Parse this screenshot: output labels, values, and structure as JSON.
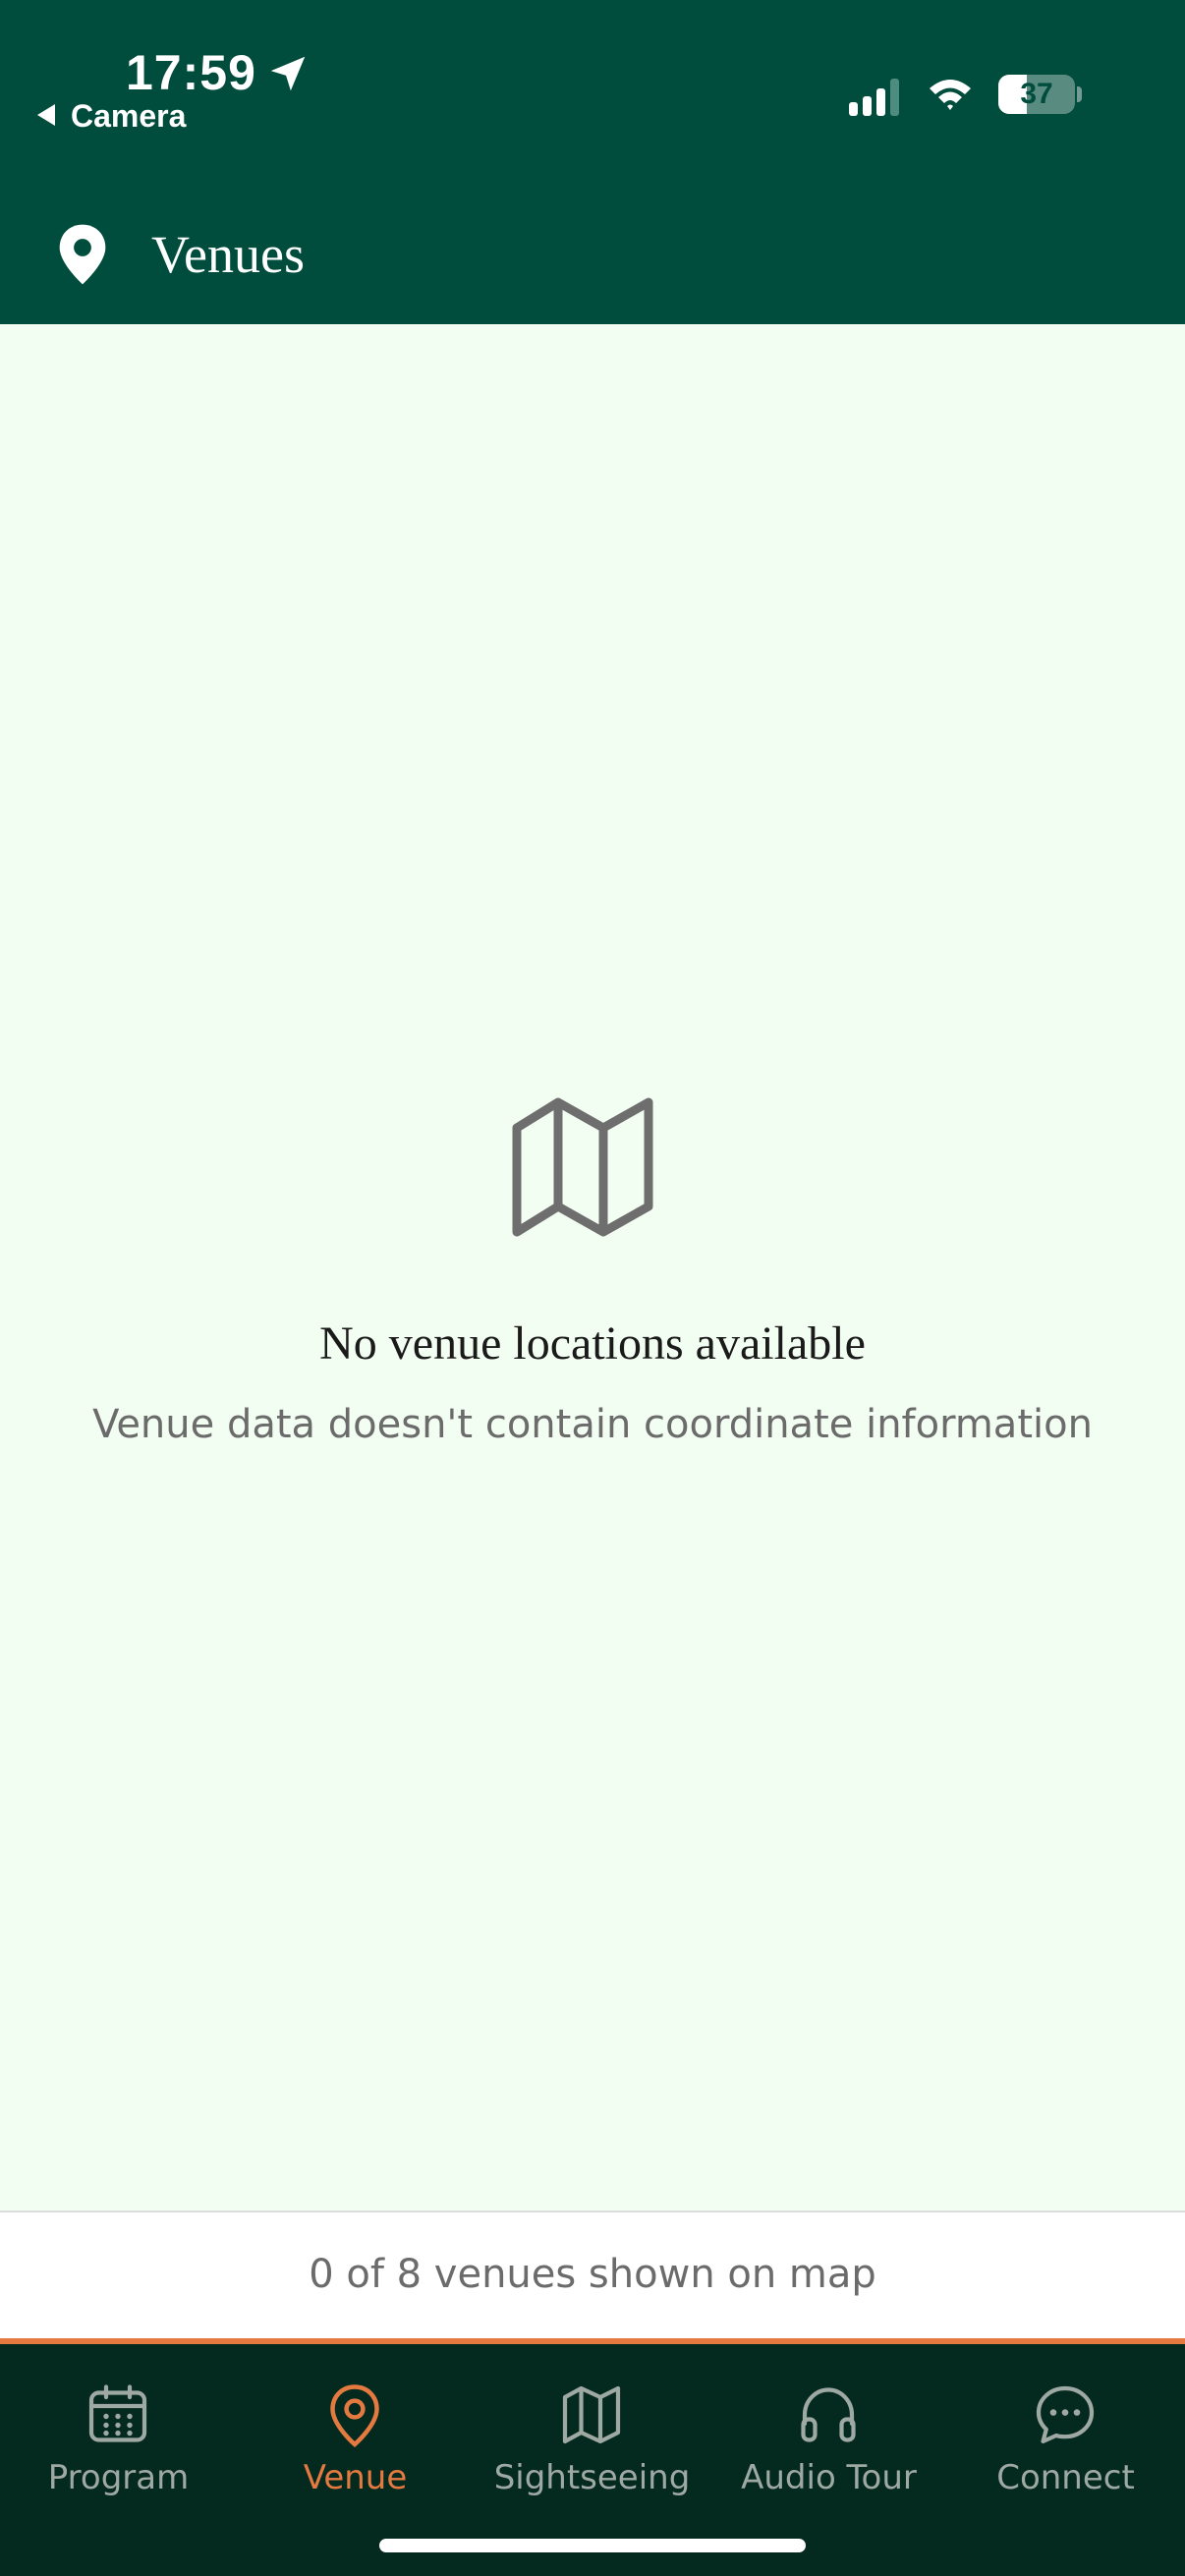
{
  "status_bar": {
    "time": "17:59",
    "back_label": "Camera",
    "battery_level": 37,
    "battery_text": "37"
  },
  "header": {
    "title": "Venues",
    "icon": "map-pin-icon"
  },
  "empty_state": {
    "icon": "folded-map-icon",
    "title": "No venue locations available",
    "subtitle": "Venue data doesn't contain coordinate information"
  },
  "footer": {
    "summary": "0 of 8 venues shown on map"
  },
  "tab_bar": {
    "tabs": [
      {
        "label": "Program",
        "icon": "calendar-icon",
        "active": false
      },
      {
        "label": "Venue",
        "icon": "map-pin-icon",
        "active": true
      },
      {
        "label": "Sightseeing",
        "icon": "map-icon",
        "active": false
      },
      {
        "label": "Audio Tour",
        "icon": "headphones-icon",
        "active": false
      },
      {
        "label": "Connect",
        "icon": "chat-bubble-icon",
        "active": false
      }
    ]
  },
  "colors": {
    "header_bg": "#004d3d",
    "page_bg": "#f3fef2",
    "accent": "#e47a40",
    "tabbar_bg": "#04291f",
    "tab_inactive": "#9fa9a4"
  }
}
